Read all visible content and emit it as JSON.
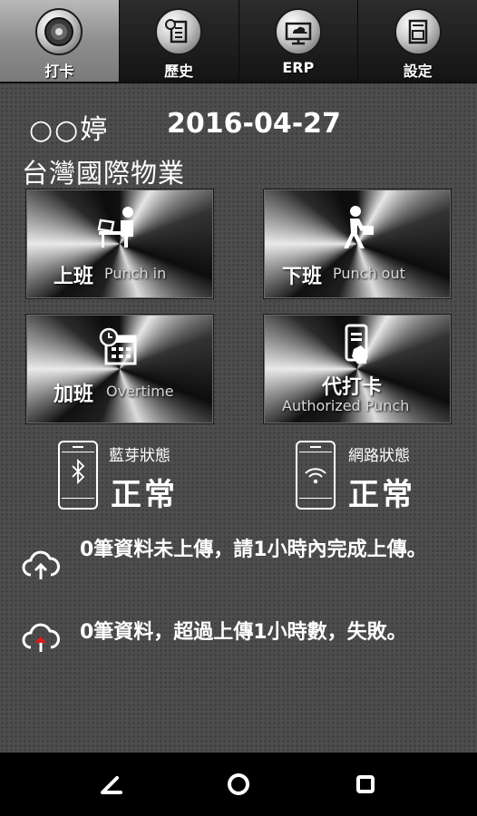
{
  "tabs": [
    {
      "label": "打卡",
      "icon": "punch-clock-icon",
      "active": true
    },
    {
      "label": "歷史",
      "icon": "history-document-icon",
      "active": false
    },
    {
      "label": "ERP",
      "icon": "cloud-monitor-icon",
      "active": false
    },
    {
      "label": "設定",
      "icon": "settings-card-icon",
      "active": false
    }
  ],
  "header": {
    "user_name": "○○婷",
    "date": "2016-04-27",
    "company": "台灣國際物業"
  },
  "buttons": {
    "punch_in": {
      "label": "上班",
      "sub": "Punch in",
      "icon": "person-at-desk-icon"
    },
    "punch_out": {
      "label": "下班",
      "sub": "Punch out",
      "icon": "person-walking-icon"
    },
    "overtime": {
      "label": "加班",
      "sub": "Overtime",
      "icon": "calendar-clock-icon"
    },
    "authorized": {
      "label": "代打卡",
      "sub": "Authorized Punch",
      "icon": "phone-hand-icon"
    }
  },
  "status": {
    "bluetooth": {
      "title": "藍芽狀態",
      "value": "正常",
      "icon": "bluetooth-phone-icon"
    },
    "network": {
      "title": "網路狀態",
      "value": "正常",
      "icon": "wifi-phone-icon"
    }
  },
  "uploads": [
    {
      "text": "0筆資料未上傳，請1小時內完成上傳。",
      "icon": "cloud-upload-icon"
    },
    {
      "text": "0筆資料，超過上傳1小時數，失敗。",
      "icon": "cloud-upload-error-icon"
    }
  ],
  "colors": {
    "error_accent": "#d21e1e",
    "background": "#4d4d4d"
  }
}
